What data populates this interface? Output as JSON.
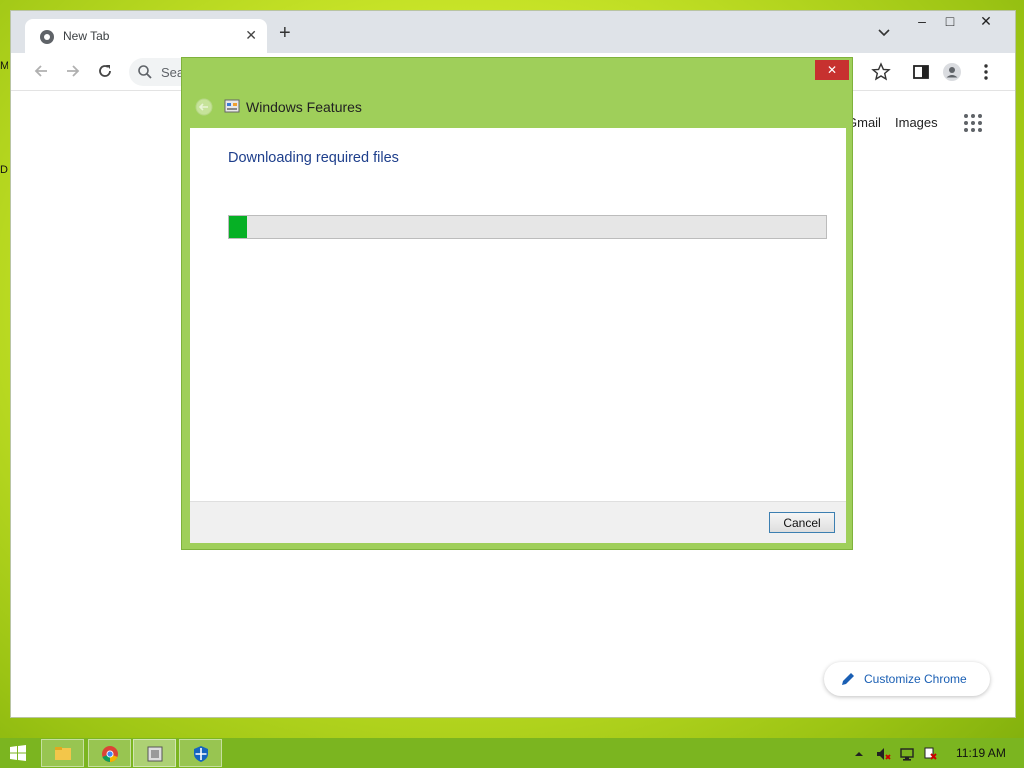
{
  "desktop": {
    "edge_labels": [
      "M",
      "D"
    ]
  },
  "browser": {
    "tab_title": "New Tab",
    "omnibox_placeholder": "Sea",
    "links": {
      "gmail": "Gmail",
      "images": "Images"
    },
    "customize_label": "Customize Chrome"
  },
  "dialog": {
    "title": "Windows Features",
    "heading": "Downloading required files",
    "progress_fraction": 0.03,
    "cancel_label": "Cancel",
    "close_glyph": "✕",
    "colors": {
      "frame": "#9fcf5a",
      "progress": "#06b025",
      "heading": "#1e3f8c"
    }
  },
  "taskbar": {
    "apps": [
      "file-explorer",
      "chrome",
      "windows-features",
      "windows-defender"
    ],
    "clock": "11:19 AM"
  }
}
